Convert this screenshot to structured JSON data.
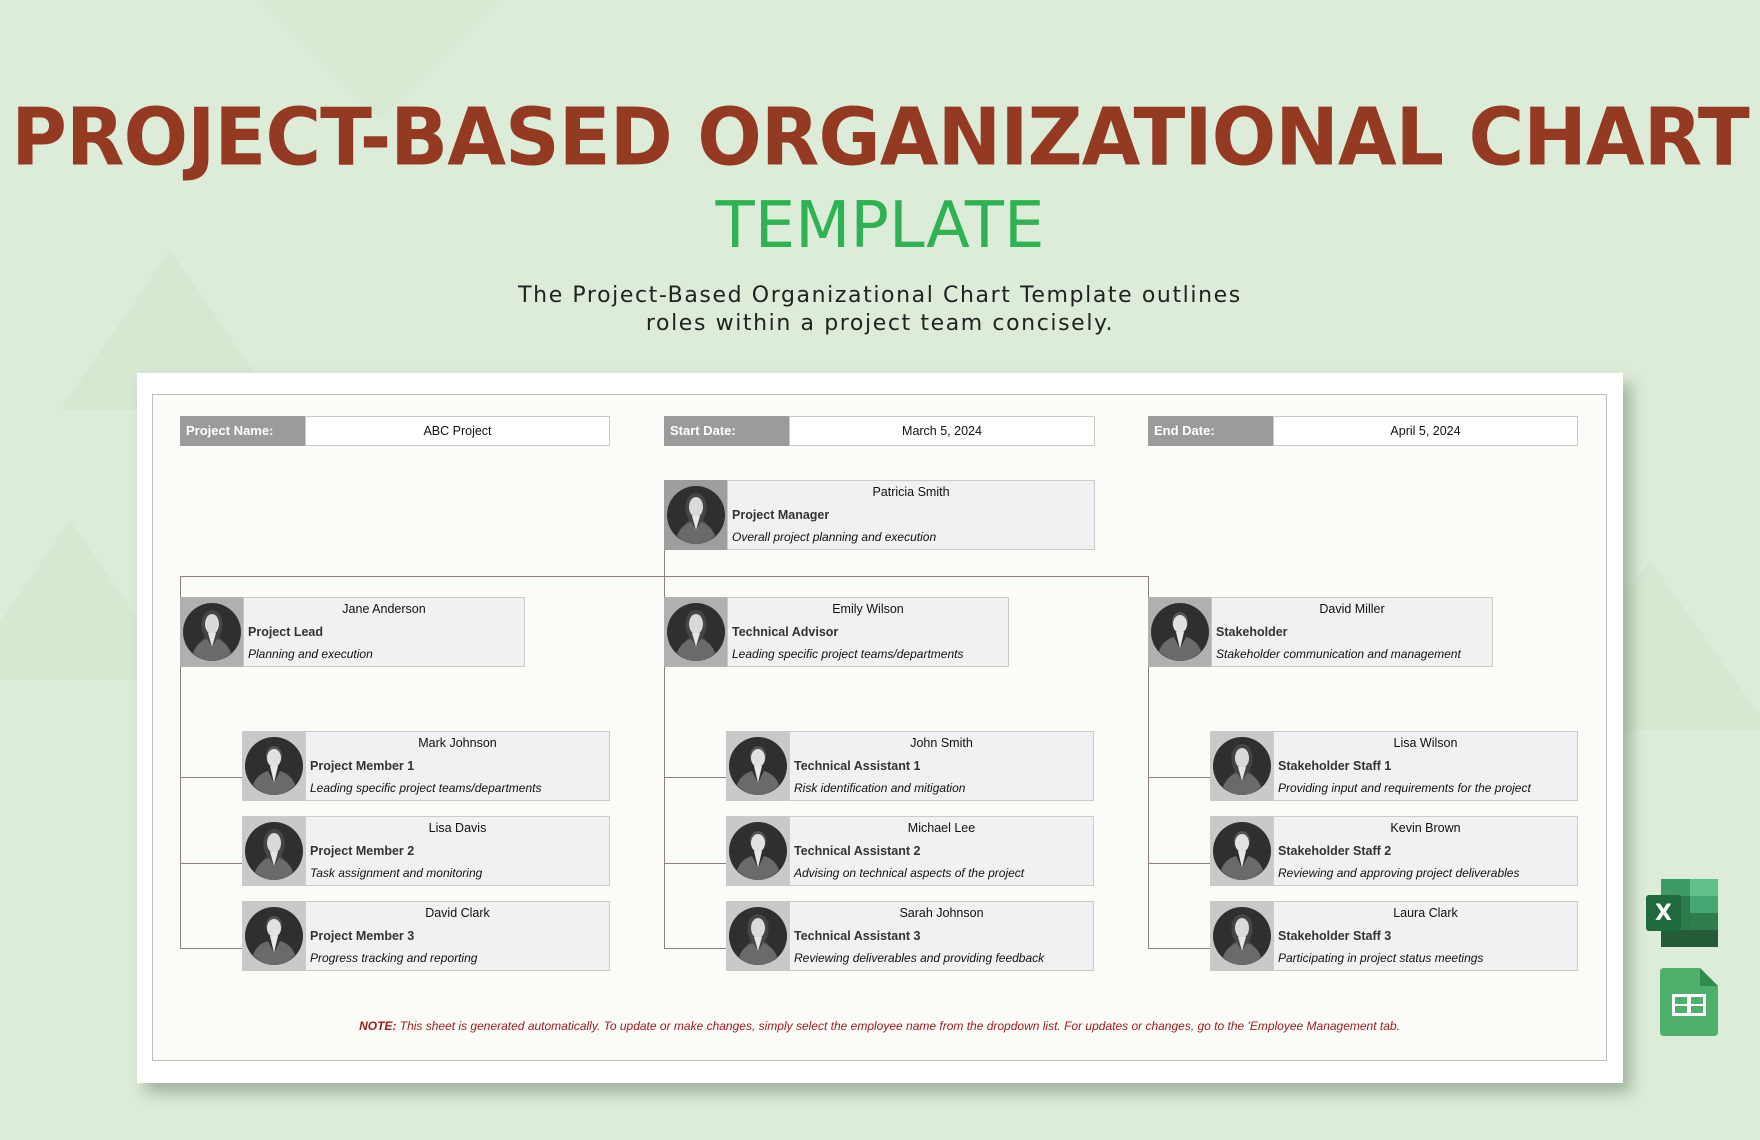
{
  "header": {
    "title": "PROJECT-BASED ORGANIZATIONAL CHART",
    "subtitle": "TEMPLATE",
    "description_line1": "The Project-Based Organizational Chart Template outlines",
    "description_line2": "roles within a project team concisely."
  },
  "fields": {
    "project_name": {
      "label": "Project Name:",
      "value": "ABC Project"
    },
    "start_date": {
      "label": "Start Date:",
      "value": "March 5, 2024"
    },
    "end_date": {
      "label": "End Date:",
      "value": "April 5, 2024"
    }
  },
  "manager": {
    "name": "Patricia Smith",
    "role": "Project Manager",
    "responsibility": "Overall project planning and execution",
    "avatar": "female-avatar-icon"
  },
  "branches": [
    {
      "lead": {
        "name": "Jane Anderson",
        "role": "Project Lead",
        "responsibility": "Planning and execution",
        "avatar": "female-avatar-icon"
      },
      "members": [
        {
          "name": "Mark Johnson",
          "role": "Project Member 1",
          "responsibility": "Leading specific project teams/departments",
          "avatar": "male-avatar-icon"
        },
        {
          "name": "Lisa Davis",
          "role": "Project Member 2",
          "responsibility": "Task assignment and monitoring",
          "avatar": "female-avatar-icon"
        },
        {
          "name": "David Clark",
          "role": "Project Member 3",
          "responsibility": "Progress tracking and reporting",
          "avatar": "male-avatar-icon"
        }
      ]
    },
    {
      "lead": {
        "name": "Emily Wilson",
        "role": "Technical Advisor",
        "responsibility": "Leading specific project teams/departments",
        "avatar": "female-avatar-icon"
      },
      "members": [
        {
          "name": "John Smith",
          "role": "Technical Assistant 1",
          "responsibility": "Risk identification and mitigation",
          "avatar": "male-avatar-icon"
        },
        {
          "name": "Michael Lee",
          "role": "Technical Assistant 2",
          "responsibility": "Advising on technical aspects of the project",
          "avatar": "male-avatar-icon"
        },
        {
          "name": "Sarah Johnson",
          "role": "Technical Assistant 3",
          "responsibility": "Reviewing deliverables and providing feedback",
          "avatar": "female-avatar-icon"
        }
      ]
    },
    {
      "lead": {
        "name": "David Miller",
        "role": "Stakeholder",
        "responsibility": "Stakeholder communication and management",
        "avatar": "male-avatar-icon"
      },
      "members": [
        {
          "name": "Lisa Wilson",
          "role": "Stakeholder Staff 1",
          "responsibility": "Providing input and requirements for the project",
          "avatar": "female-avatar-icon"
        },
        {
          "name": "Kevin Brown",
          "role": "Stakeholder Staff 2",
          "responsibility": "Reviewing and approving project deliverables",
          "avatar": "male-avatar-icon"
        },
        {
          "name": "Laura Clark",
          "role": "Stakeholder Staff 3",
          "responsibility": "Participating in project status meetings",
          "avatar": "female-avatar-icon"
        }
      ]
    }
  ],
  "note": {
    "prefix": "NOTE:",
    "text": " This sheet is generated automatically. To update or make changes, simply select the employee name from the dropdown list. For updates or changes, go to the 'Employee Management tab."
  },
  "app_icons": [
    "excel-icon",
    "google-sheets-icon"
  ],
  "colors": {
    "title": "#953a22",
    "subtitle": "#2fb254",
    "note": "#9b1b1b",
    "background": "#dcecd8"
  }
}
